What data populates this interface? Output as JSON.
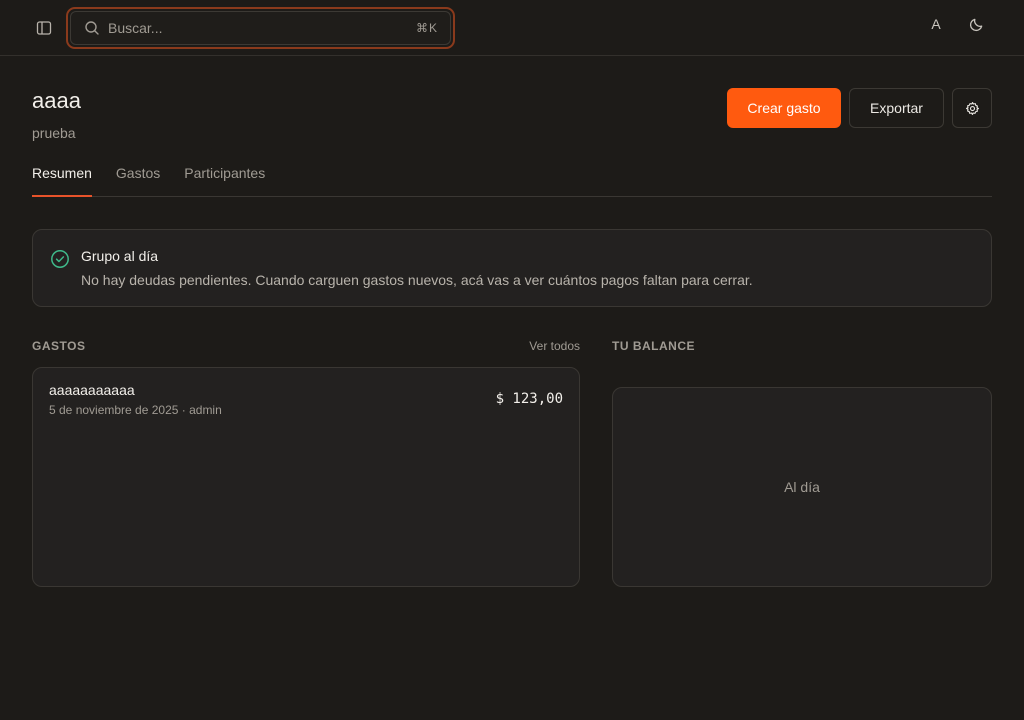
{
  "topbar": {
    "search_placeholder": "Buscar...",
    "search_shortcut": "⌘K",
    "lang_label": "A"
  },
  "group": {
    "name": "aaaa",
    "description": "prueba"
  },
  "actions": {
    "create_label": "Crear gasto",
    "export_label": "Exportar"
  },
  "tabs": [
    {
      "label": "Resumen",
      "active": true
    },
    {
      "label": "Gastos",
      "active": false
    },
    {
      "label": "Participantes",
      "active": false
    }
  ],
  "status_alert": {
    "title": "Grupo al día",
    "description": "No hay deudas pendientes. Cuando carguen gastos nuevos, acá vas a ver cuántos pagos faltan para cerrar."
  },
  "expenses": {
    "heading": "GASTOS",
    "see_all": "Ver todos",
    "items": [
      {
        "name": "aaaaaaaaaaa",
        "meta": "5 de noviembre de 2025 · admin",
        "amount": "$ 123,00"
      }
    ]
  },
  "balance": {
    "heading": "TU BALANCE",
    "status": "Al día"
  },
  "colors": {
    "accent": "#ff5a0f",
    "tab_underline": "#e8532a",
    "success": "#3fb98a",
    "background": "#1d1b18"
  }
}
